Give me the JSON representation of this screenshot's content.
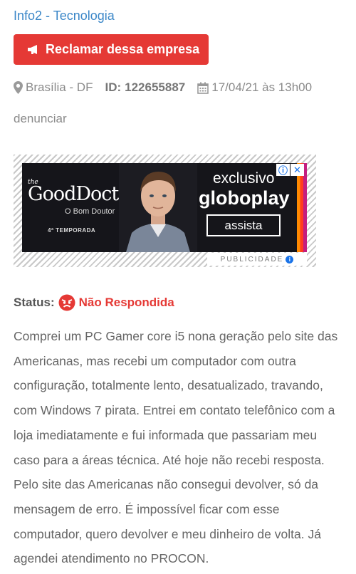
{
  "company": {
    "name": "Info2 - Tecnologia"
  },
  "complain_button": {
    "label": "Reclamar dessa empresa",
    "color": "#e53935"
  },
  "meta": {
    "location": "Brasília - DF",
    "id_label": "ID:",
    "id_value": "122655887",
    "datetime": "17/04/21 às 13h00"
  },
  "report_link": "denunciar",
  "ad": {
    "show_title": "GoodDoctor",
    "show_title_prefix": "the",
    "show_subtitle": "O Bom Doutor",
    "season": "4ª TEMPORADA",
    "exclusive": "exclusivo",
    "brand": "globoplay",
    "cta": "assista",
    "label": "PUBLICIDADE",
    "icons": [
      "info-icon",
      "close-icon"
    ]
  },
  "status": {
    "label": "Status:",
    "value": "Não Respondida",
    "color": "#e53935"
  },
  "complaint": {
    "text": "Comprei um PC Gamer core i5 nona geração pelo site das Americanas, mas recebi um computador com outra configuração, totalmente lento, desatualizado, travando, com Windows 7 pirata. Entrei em contato telefônico com a loja imediatamente e fui informada que passariam meu caso para a áreas técnica. Até hoje não recebi resposta. Pelo site das Americanas não consegui devolver, só da mensagem de erro. É impossível ficar com esse computador, quero devolver e meu dinheiro de volta. Já agendei atendimento no PROCON."
  }
}
